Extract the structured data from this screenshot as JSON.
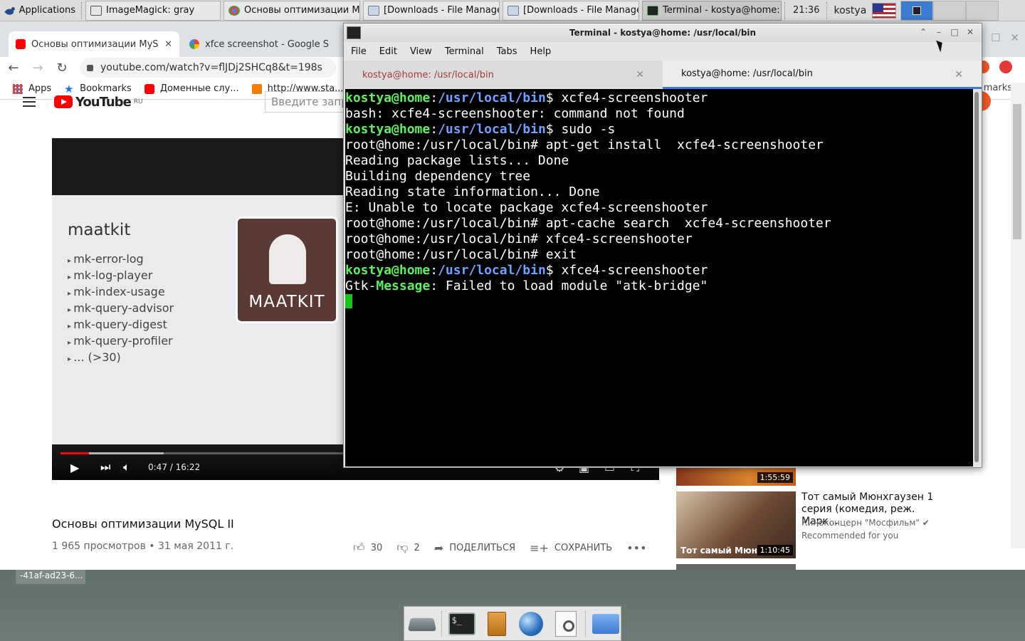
{
  "panel": {
    "applications_label": "Applications",
    "tasks": [
      {
        "label": "ImageMagick: gray"
      },
      {
        "label": "Основы оптимизации Му..."
      },
      {
        "label": "[Downloads - File Manager]"
      },
      {
        "label": "[Downloads - File Manager]"
      },
      {
        "label": "Terminal - kostya@home: ..."
      }
    ],
    "clock": "21:36",
    "user": "kostya"
  },
  "chrome": {
    "tabs": [
      {
        "label": "Основы оптимизации MyS"
      },
      {
        "label": "xfce screenshot - Google S"
      }
    ],
    "url": "youtube.com/watch?v=flJDj2SHCq8&t=198s",
    "bookmarks": [
      {
        "label": "Apps"
      },
      {
        "label": "Bookmarks"
      },
      {
        "label": "Доменные слу..."
      },
      {
        "label": "http://www.sta..."
      }
    ],
    "bookmarks_right": "marks"
  },
  "youtube": {
    "logo_word": "YouTube",
    "logo_region": "RU",
    "search_placeholder": "Введите запрос",
    "slide": {
      "heading": "maatkit",
      "items": [
        "mk-error-log",
        "mk-log-player",
        "mk-index-usage",
        "mk-query-advisor",
        "mk-query-digest",
        "mk-query-profiler",
        "... (>30)"
      ],
      "logo_text": "MAATKIT"
    },
    "player": {
      "time": "0:47 / 16:22",
      "played_fraction": 0.048,
      "buffered_fraction": 0.175
    },
    "title": "Основы оптимизации MySQL II",
    "meta": "1 965 просмотров • 31 мая 2011 г.",
    "actions": {
      "likes": "30",
      "dislikes": "2",
      "share": "ПОДЕЛИТЬСЯ",
      "save": "СОХРАНИТЬ"
    },
    "reco": [
      {
        "duration": "1:55:59"
      },
      {
        "duration": "1:10:45",
        "thumb_caption": "Тот самый Мюн",
        "title": "Тот самый Мюнхгаузен 1 серия (комедия, реж. Марк...",
        "channel": "Киноконцерн \"Мосфильм\" ✔",
        "reason": "Recommended for you"
      }
    ]
  },
  "terminal": {
    "title": "Terminal - kostya@home: /usr/local/bin",
    "menu": [
      "File",
      "Edit",
      "View",
      "Terminal",
      "Tabs",
      "Help"
    ],
    "tabs": [
      {
        "label": "kostya@home: /usr/local/bin"
      },
      {
        "label": "kostya@home: /usr/local/bin"
      }
    ],
    "prompt_user": "kostya@home",
    "prompt_path": "/usr/local/bin",
    "lines": {
      "l1_cmd": "$ xcfe4-screenshooter",
      "l2": "bash: xcfe4-screenshooter: command not found",
      "l3_cmd": "$ sudo -s",
      "l4": "root@home:/usr/local/bin# apt-get install  xcfe4-screenshooter",
      "l5": "Reading package lists... Done",
      "l6": "Building dependency tree",
      "l7": "Reading state information... Done",
      "l8": "E: Unable to locate package xcfe4-screenshooter",
      "l9": "root@home:/usr/local/bin# apt-cache search  xcfe4-screenshooter",
      "l10": "root@home:/usr/local/bin# xfce4-screenshooter",
      "l11": "root@home:/usr/local/bin# exit",
      "l12_cmd": "$ xfce4-screenshooter",
      "l13_a": "Gtk-",
      "l13_b": "Message",
      "l13_c": ": Failed to load module \"atk-bridge\""
    }
  },
  "desktop": {
    "label": "-41af-ad23-6..."
  },
  "colors": {
    "prompt_user": "#5eef5e",
    "prompt_path": "#6fa2ff",
    "youtube_red": "#ff0000",
    "terminal_bg": "#000000"
  }
}
